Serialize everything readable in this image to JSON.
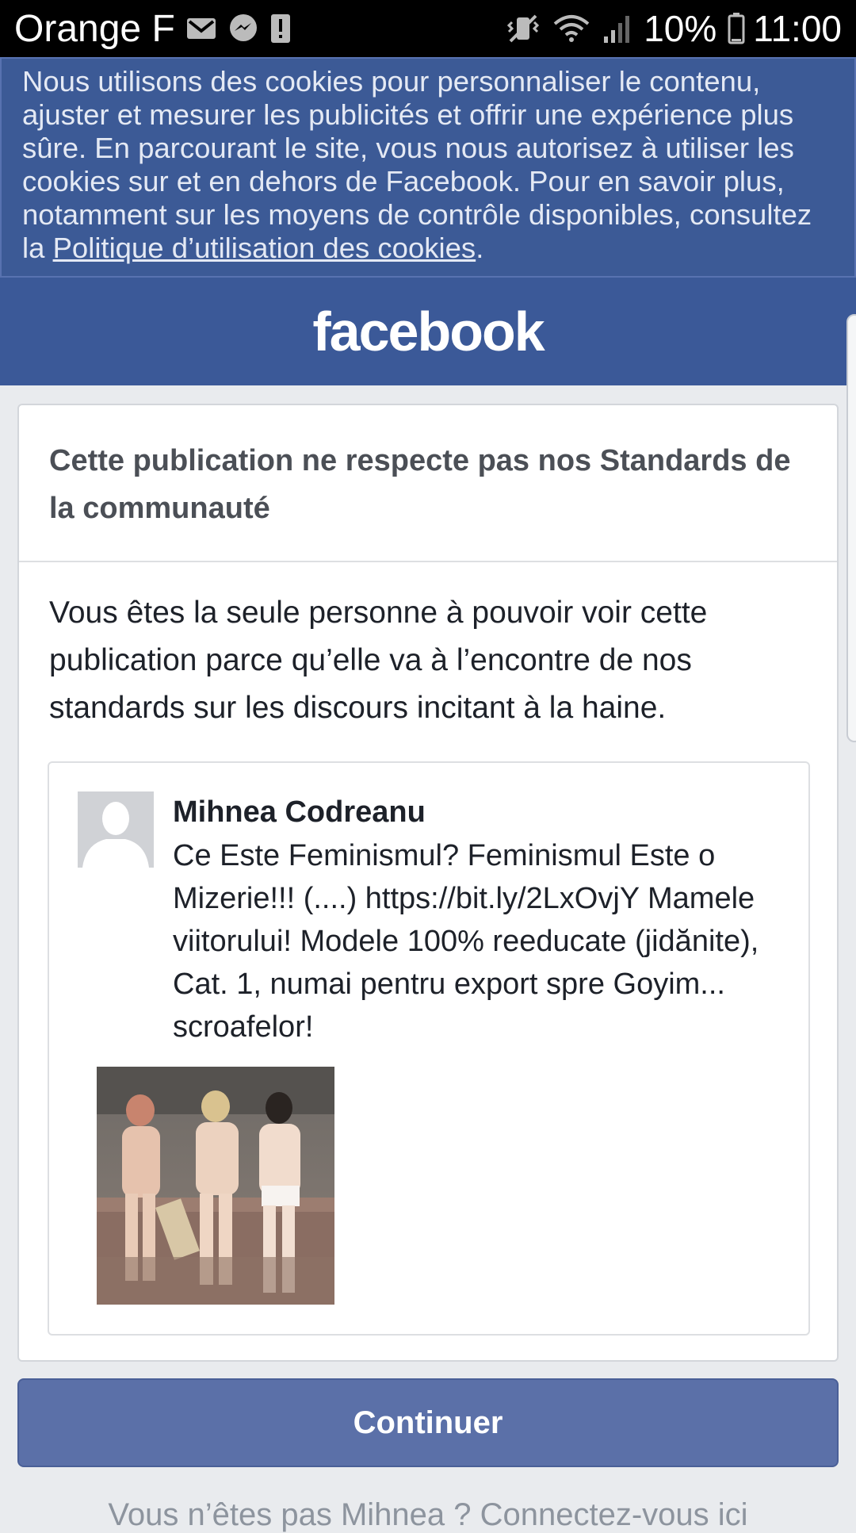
{
  "status_bar": {
    "carrier": "Orange F",
    "battery": "10%",
    "time": "11:00",
    "icons": [
      "gmail-icon",
      "messenger-icon",
      "alert-icon",
      "vibrate-icon",
      "wifi-icon",
      "signal-icon",
      "battery-icon"
    ]
  },
  "cookie_banner": {
    "text": "Nous utilisons des cookies pour personnaliser le contenu, ajuster et mesurer les publicités et offrir une expérience plus sûre. En parcourant le site, vous nous autorisez à utiliser les cookies sur et en dehors de Facebook. Pour en savoir plus, notamment sur les moyens de contrôle disponibles, consultez la ",
    "link_text": "Politique d’utilisation des cookies",
    "trailing": "."
  },
  "header": {
    "logo": "facebook"
  },
  "notice": {
    "title": "Cette publication ne respecte pas nos Standards de la communauté",
    "body": "Vous êtes la seule personne à pouvoir voir cette publication parce qu’elle va à l’encontre de nos standards sur les discours incitant à la haine."
  },
  "post": {
    "author": "Mihnea Codreanu",
    "text": "Ce Este Feminismul? Feminismul Este o Mizerie!!! (....) https://bit.ly/2LxOvjY Mamele viitorului! Modele 100% reeducate (jidănite), Cat. 1, numai pentru export spre Goyim... scroafelor!"
  },
  "actions": {
    "continue_label": "Continuer",
    "login_text": "Vous n’êtes pas Mihnea ? Connectez-vous ici"
  },
  "colors": {
    "facebook_blue": "#3b5998",
    "banner_blue": "#3c5a96",
    "button_blue": "#5b70a8",
    "page_bg": "#e9ebee"
  }
}
